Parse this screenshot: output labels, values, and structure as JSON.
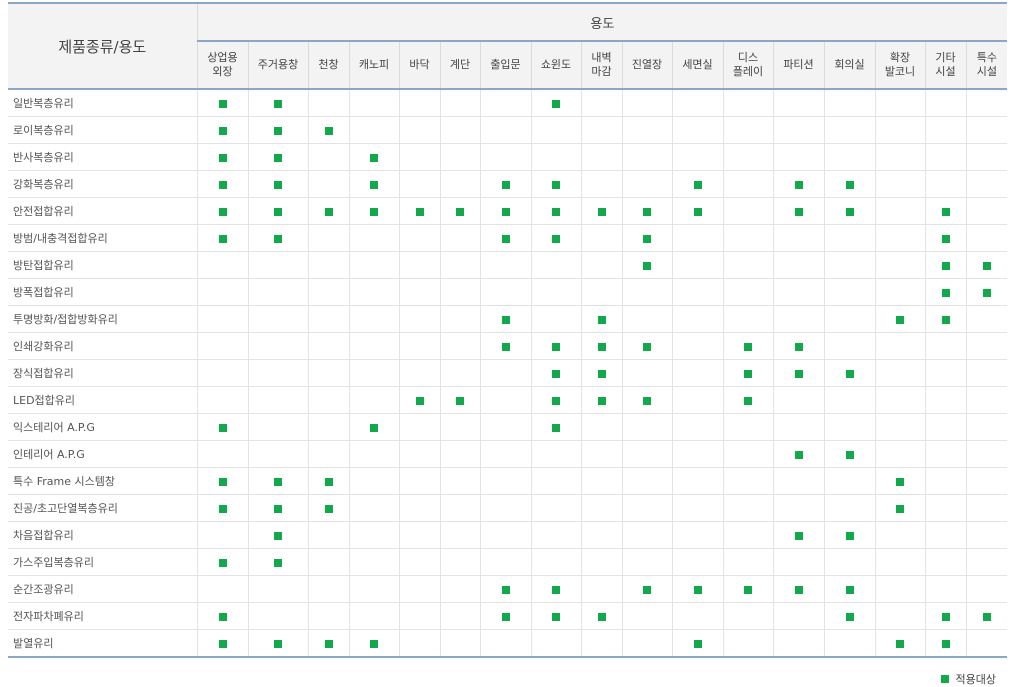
{
  "table": {
    "corner_label": "제품종류/용도",
    "group_label": "용도",
    "columns": [
      "상업용\n외장",
      "주거용창",
      "천창",
      "캐노피",
      "바닥",
      "계단",
      "출입문",
      "쇼윈도",
      "내벽\n마감",
      "진열장",
      "세면실",
      "디스\n플레이",
      "파티션",
      "회의실",
      "확장\n발코니",
      "기타\n시설",
      "특수\n시설"
    ],
    "rows": [
      {
        "name": "일반복층유리",
        "marks": [
          1,
          1,
          0,
          0,
          0,
          0,
          0,
          1,
          0,
          0,
          0,
          0,
          0,
          0,
          0,
          0,
          0
        ]
      },
      {
        "name": "로이복층유리",
        "marks": [
          1,
          1,
          1,
          0,
          0,
          0,
          0,
          0,
          0,
          0,
          0,
          0,
          0,
          0,
          0,
          0,
          0
        ]
      },
      {
        "name": "반사복층유리",
        "marks": [
          1,
          1,
          0,
          1,
          0,
          0,
          0,
          0,
          0,
          0,
          0,
          0,
          0,
          0,
          0,
          0,
          0
        ]
      },
      {
        "name": "강화복층유리",
        "marks": [
          1,
          1,
          0,
          1,
          0,
          0,
          1,
          1,
          0,
          0,
          1,
          0,
          1,
          1,
          0,
          0,
          0
        ]
      },
      {
        "name": "안전접합유리",
        "marks": [
          1,
          1,
          1,
          1,
          1,
          1,
          1,
          1,
          1,
          1,
          1,
          0,
          1,
          1,
          0,
          1,
          0
        ]
      },
      {
        "name": "방범/내충격접합유리",
        "marks": [
          1,
          1,
          0,
          0,
          0,
          0,
          1,
          1,
          0,
          1,
          0,
          0,
          0,
          0,
          0,
          1,
          0
        ]
      },
      {
        "name": "방탄접합유리",
        "marks": [
          0,
          0,
          0,
          0,
          0,
          0,
          0,
          0,
          0,
          1,
          0,
          0,
          0,
          0,
          0,
          1,
          1
        ]
      },
      {
        "name": "방폭접합유리",
        "marks": [
          0,
          0,
          0,
          0,
          0,
          0,
          0,
          0,
          0,
          0,
          0,
          0,
          0,
          0,
          0,
          1,
          1
        ]
      },
      {
        "name": "투명방화/접합방화유리",
        "marks": [
          0,
          0,
          0,
          0,
          0,
          0,
          1,
          0,
          1,
          0,
          0,
          0,
          0,
          0,
          1,
          1,
          0
        ]
      },
      {
        "name": "인쇄강화유리",
        "marks": [
          0,
          0,
          0,
          0,
          0,
          0,
          1,
          1,
          1,
          1,
          0,
          1,
          1,
          0,
          0,
          0,
          0
        ]
      },
      {
        "name": "장식접합유리",
        "marks": [
          0,
          0,
          0,
          0,
          0,
          0,
          0,
          1,
          1,
          0,
          0,
          1,
          1,
          1,
          0,
          0,
          0
        ]
      },
      {
        "name": "LED접합유리",
        "marks": [
          0,
          0,
          0,
          0,
          1,
          1,
          0,
          1,
          1,
          1,
          0,
          1,
          0,
          0,
          0,
          0,
          0
        ]
      },
      {
        "name": "익스테리어 A.P.G",
        "marks": [
          1,
          0,
          0,
          1,
          0,
          0,
          0,
          1,
          0,
          0,
          0,
          0,
          0,
          0,
          0,
          0,
          0
        ]
      },
      {
        "name": "인테리어 A.P.G",
        "marks": [
          0,
          0,
          0,
          0,
          0,
          0,
          0,
          0,
          0,
          0,
          0,
          0,
          1,
          1,
          0,
          0,
          0
        ]
      },
      {
        "name": "특수 Frame 시스템창",
        "marks": [
          1,
          1,
          1,
          0,
          0,
          0,
          0,
          0,
          0,
          0,
          0,
          0,
          0,
          0,
          1,
          0,
          0
        ]
      },
      {
        "name": "진공/초고단열복층유리",
        "marks": [
          1,
          1,
          1,
          0,
          0,
          0,
          0,
          0,
          0,
          0,
          0,
          0,
          0,
          0,
          1,
          0,
          0
        ]
      },
      {
        "name": "차음접합유리",
        "marks": [
          0,
          1,
          0,
          0,
          0,
          0,
          0,
          0,
          0,
          0,
          0,
          0,
          1,
          1,
          0,
          0,
          0
        ]
      },
      {
        "name": "가스주입복층유리",
        "marks": [
          1,
          1,
          0,
          0,
          0,
          0,
          0,
          0,
          0,
          0,
          0,
          0,
          0,
          0,
          0,
          0,
          0
        ]
      },
      {
        "name": "순간조광유리",
        "marks": [
          0,
          0,
          0,
          0,
          0,
          0,
          1,
          1,
          0,
          1,
          1,
          1,
          1,
          1,
          0,
          0,
          0
        ]
      },
      {
        "name": "전자파차폐유리",
        "marks": [
          1,
          0,
          0,
          0,
          0,
          0,
          1,
          1,
          1,
          0,
          0,
          0,
          0,
          1,
          0,
          1,
          1
        ]
      },
      {
        "name": "발열유리",
        "marks": [
          1,
          1,
          1,
          1,
          0,
          0,
          0,
          0,
          0,
          0,
          1,
          0,
          0,
          0,
          1,
          1,
          0
        ]
      }
    ]
  },
  "legend": {
    "label": "적용대상",
    "marker_color": "#12a94d",
    "marker_icon": "green-square-icon"
  },
  "colors": {
    "header_bg": "#f3f3f3",
    "accent_line": "#8aa7c8",
    "mark": "#12a94d"
  }
}
